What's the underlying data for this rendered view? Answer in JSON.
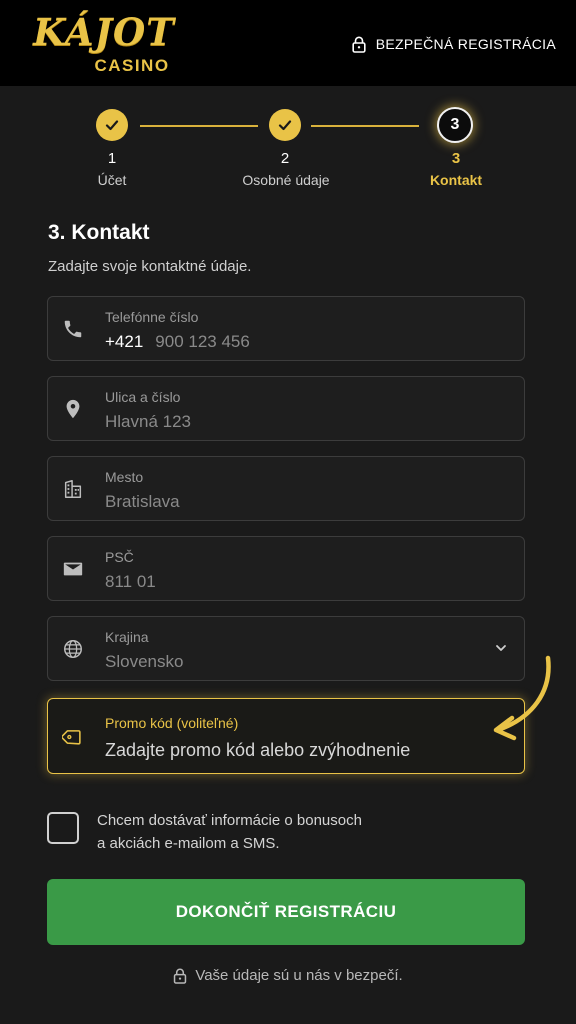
{
  "header": {
    "logo_main": "KÁJOT",
    "logo_sub": "CASINO",
    "secure_label": "BEZPEČNÁ REGISTRÁCIA"
  },
  "stepper": {
    "steps": [
      {
        "number": "1",
        "label": "Účet",
        "state": "done"
      },
      {
        "number": "2",
        "label": "Osobné údaje",
        "state": "done"
      },
      {
        "number": "3",
        "label": "Kontakt",
        "state": "active"
      }
    ]
  },
  "form": {
    "title": "3. Kontakt",
    "subtitle": "Zadajte svoje kontaktné údaje.",
    "phone": {
      "label": "Telefónne číslo",
      "prefix": "+421",
      "placeholder": "900 123 456"
    },
    "street": {
      "label": "Ulica a číslo",
      "placeholder": "Hlavná 123"
    },
    "city": {
      "label": "Mesto",
      "placeholder": "Bratislava"
    },
    "zip": {
      "label": "PSČ",
      "placeholder": "811 01"
    },
    "country": {
      "label": "Krajina",
      "value": "Slovensko"
    },
    "promo": {
      "label": "Promo kód (voliteľné)",
      "placeholder": "Zadajte promo kód alebo zvýhodnenie"
    },
    "consent_line1": "Chcem dostávať informácie o bonusoch",
    "consent_line2": "a akciách e-mailom a SMS.",
    "submit_label": "DOKONČIŤ REGISTRÁCIU",
    "footer_note": "Vaše údaje sú u nás v bezpečí."
  },
  "colors": {
    "accent": "#e9c347",
    "primary_button": "#3a9a47",
    "background": "#1a1a1a",
    "header": "#000000"
  }
}
